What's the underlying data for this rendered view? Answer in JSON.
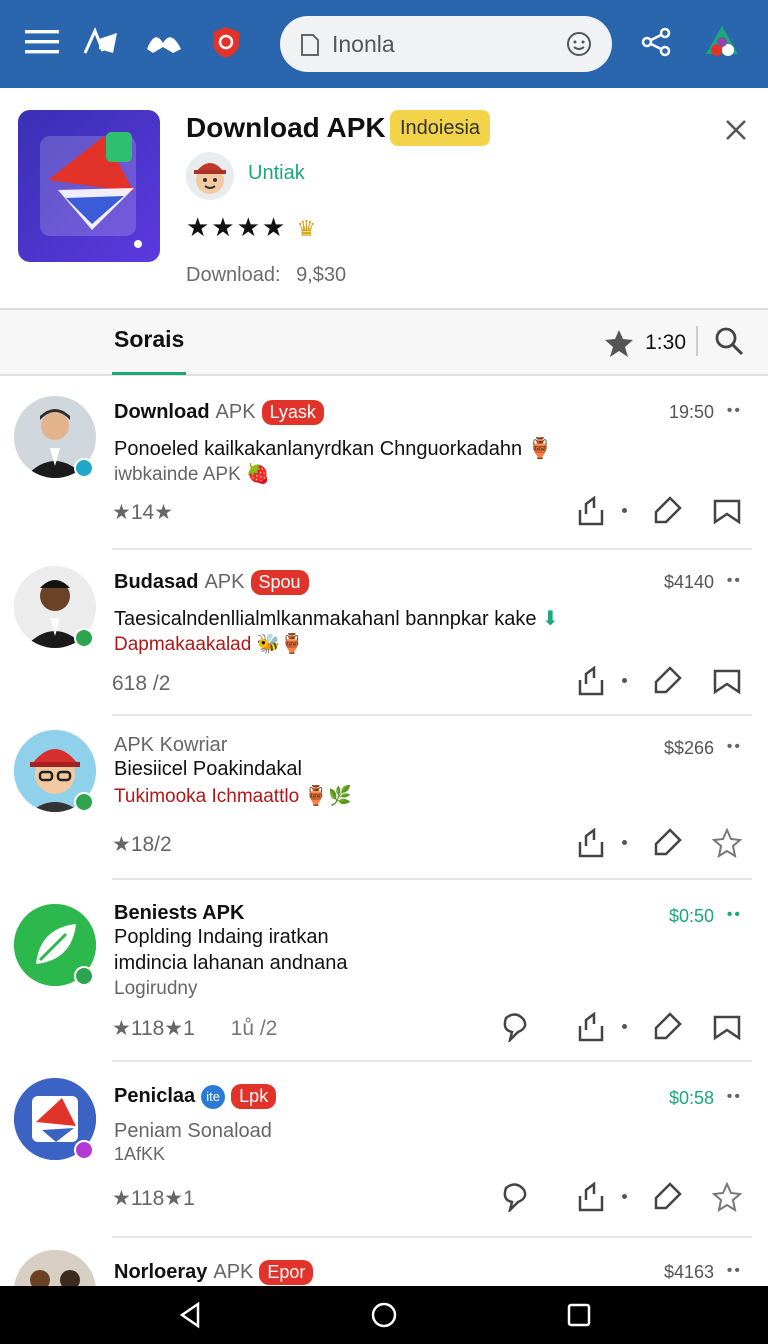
{
  "topbar": {
    "search_text": "Inonla",
    "icons": [
      "menu-icon",
      "app-icon-a",
      "app-icon-b",
      "shield-icon",
      "share-icon",
      "store-icon"
    ]
  },
  "banner": {
    "title": "Download APK",
    "badge": "Indoiesia",
    "developer": "Untiak",
    "stars": "★★★★",
    "downloads_label": "Download:",
    "downloads_value": "9,$30"
  },
  "tabs": {
    "active_tab": "Sorais",
    "rating": "1:30"
  },
  "feed": [
    {
      "name": "Download",
      "suffix": "APK",
      "pill": "Lyask",
      "time": "19:50",
      "line1": "Ponoeled kailkakanlanyrdkan Chnguorkadahn",
      "line2": "iwbkainde APK",
      "stat": "★14★",
      "line2_color": "#666666"
    },
    {
      "name": "Budasad",
      "suffix": "APK",
      "pill": "Spou",
      "time": "$4140",
      "line1": "Taesicalndenllialmlkanmakahanl bannpkar kake",
      "line2": "Dapmakaakalad",
      "stat": "618 /2",
      "line2_color": "#b01818"
    },
    {
      "name": "APK Kowriar",
      "suffix": "",
      "pill": "",
      "time": "$$266",
      "line1": "Biesiicel Poakindakal",
      "line2": "Tukimooka  Ichmaattlo",
      "stat": "★18/2",
      "line2_color": "#b01818"
    },
    {
      "name": "Beniests APK",
      "suffix": "",
      "pill": "",
      "time": "$0:50",
      "line1": "Poplding Indaing iratkan",
      "line1b": "imdincia lahanan andnana",
      "line2": "Logirudny",
      "stat": "★118★1",
      "stat2": "1ů  /2",
      "line2_color": "#666666"
    },
    {
      "name": "Peniclaa",
      "suffix": "",
      "pill": "Lpk",
      "time": "$0:58",
      "line1": "Peniam   Sonaload",
      "line2": "1AfKK",
      "stat": "★118★1",
      "line2_color": "#666666"
    },
    {
      "name": "Norloeray",
      "suffix": "APK",
      "pill": "Epor",
      "time": "$4163"
    }
  ],
  "colors": {
    "topbar": "#2a66ad",
    "accent_green": "#1aa878",
    "pill_red": "#e2332b",
    "badge_yellow": "#f3d34a"
  }
}
